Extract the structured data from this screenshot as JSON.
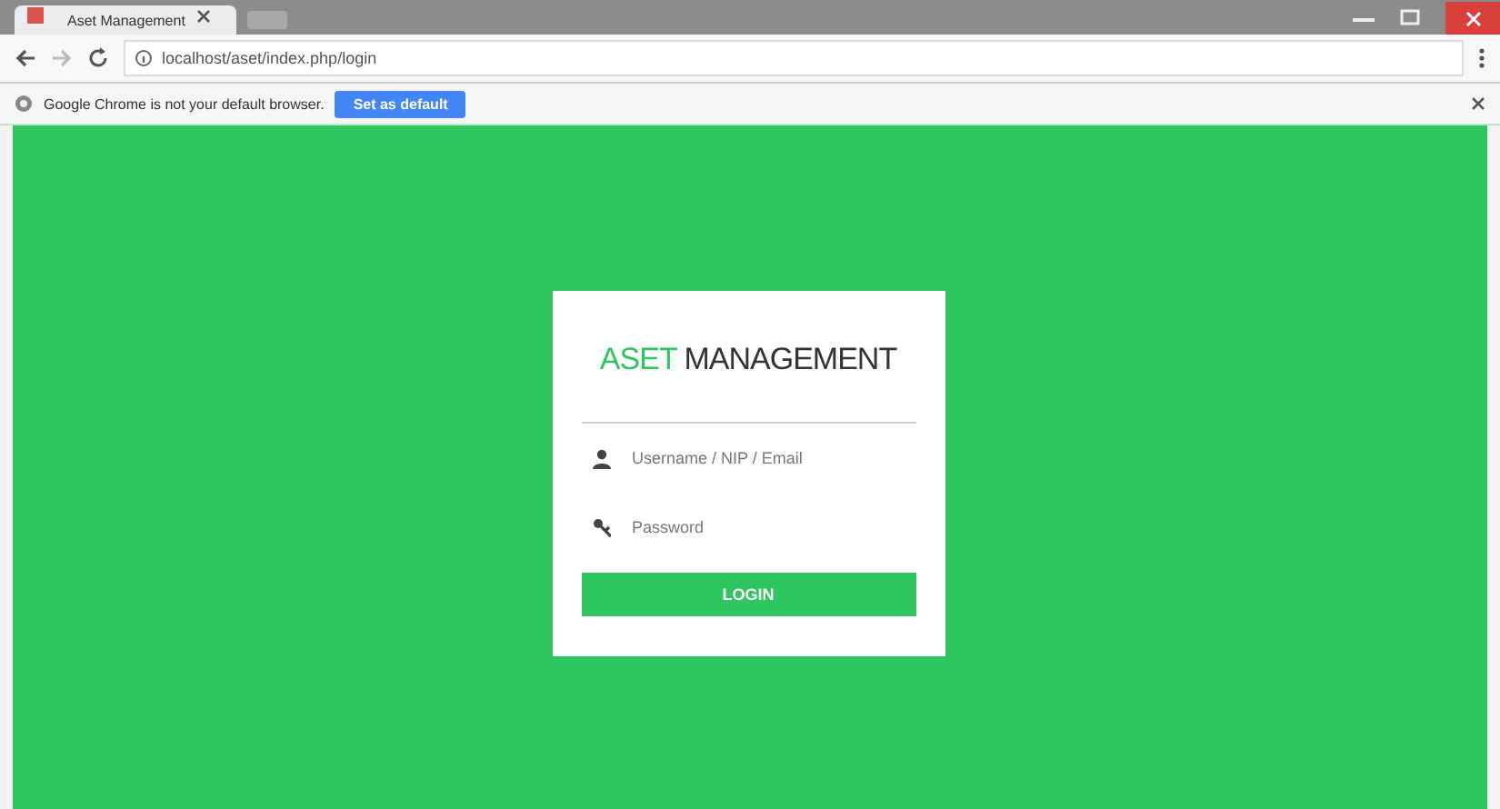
{
  "browser": {
    "tab_title": "Aset Management",
    "url": "localhost/aset/index.php/login",
    "infobar": {
      "message": "Google Chrome is not your default browser.",
      "button": "Set as default"
    }
  },
  "login": {
    "title_accent": "ASET",
    "title_rest": "MANAGEMENT",
    "fields": [
      {
        "kind": "user",
        "placeholder": "Username / NIP / Email"
      },
      {
        "kind": "key",
        "placeholder": "Password"
      }
    ],
    "button": "LOGIN"
  }
}
